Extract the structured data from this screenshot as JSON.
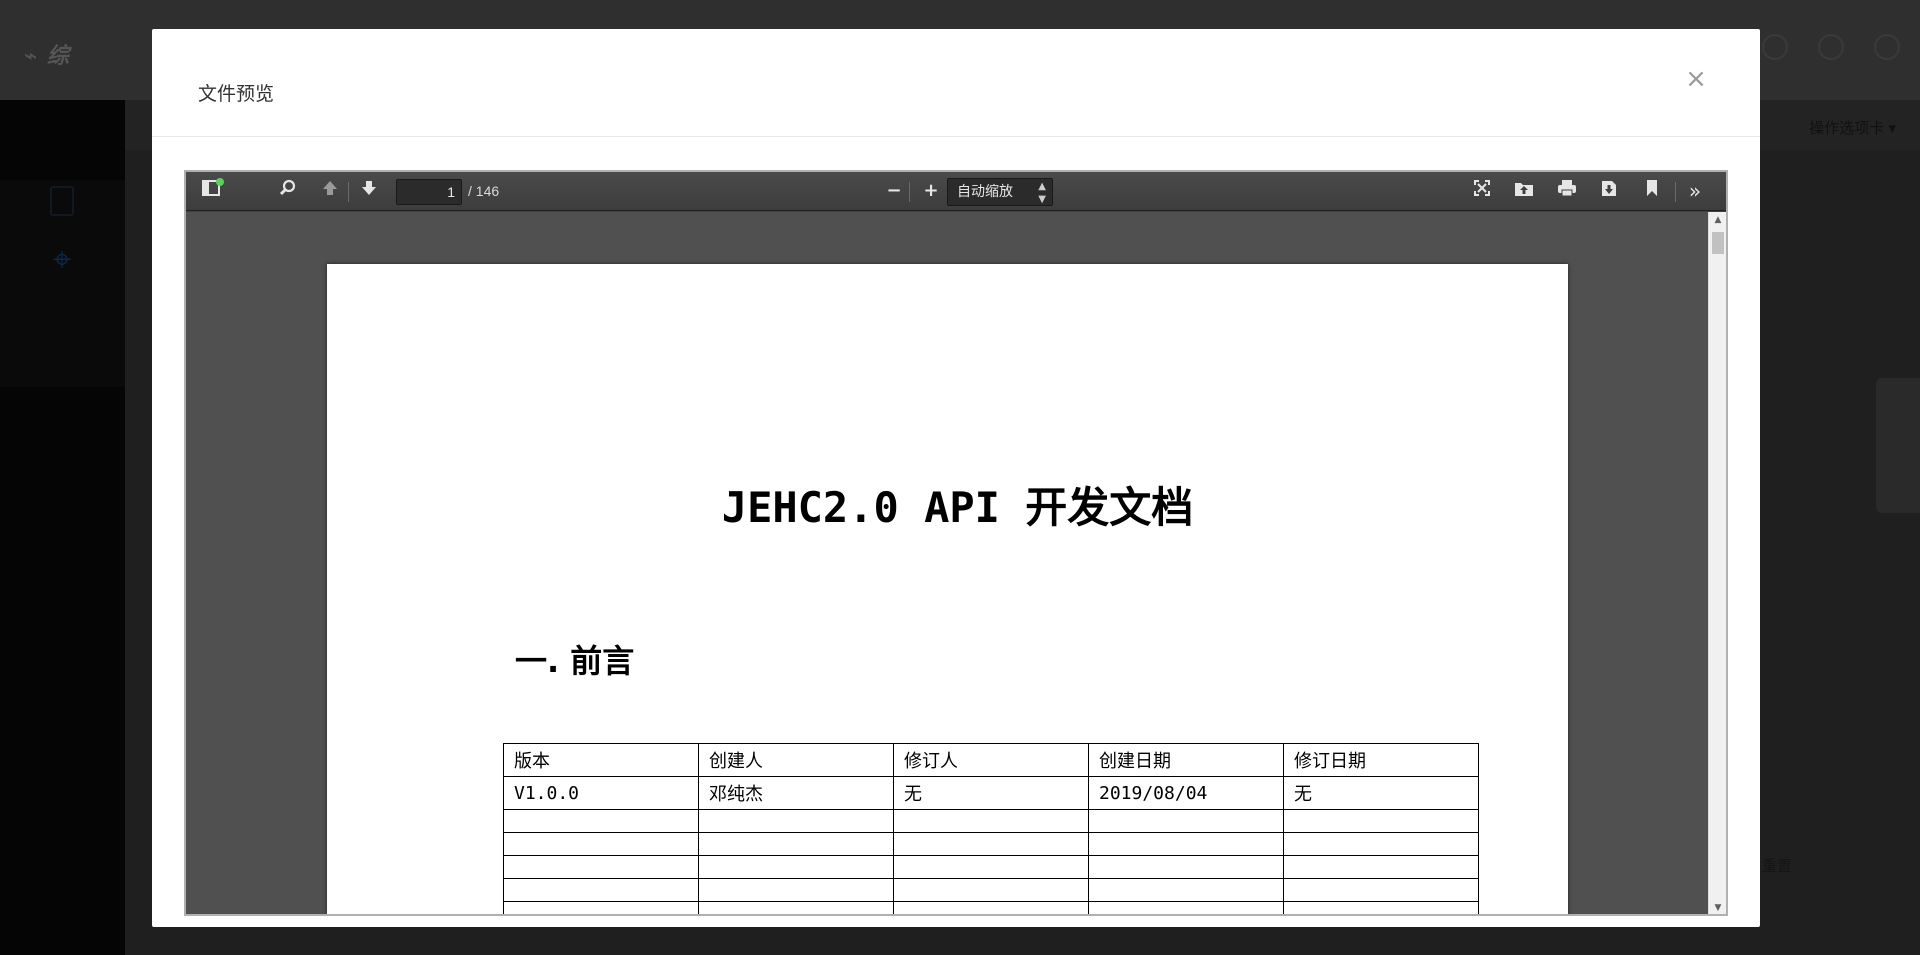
{
  "modal": {
    "title": "文件预览",
    "close_label": "×"
  },
  "background": {
    "tabs_menu": "操作选项卡 ▾",
    "reset_label": "重置"
  },
  "viewer": {
    "toolbar": {
      "current_page": "1",
      "page_total": "/ 146",
      "zoom_value": "自动缩放",
      "zoom_out": "−",
      "zoom_in": "+"
    }
  },
  "document": {
    "title": "JEHC2.0 API 开发文档",
    "section_heading": "一. 前言",
    "table": {
      "headers": [
        "版本",
        "创建人",
        "修订人",
        "创建日期",
        "修订日期"
      ],
      "rows": [
        [
          "V1.0.0",
          "邓纯杰",
          "无",
          "2019/08/04",
          "无"
        ],
        [
          "",
          "",
          "",
          "",
          ""
        ],
        [
          "",
          "",
          "",
          "",
          ""
        ],
        [
          "",
          "",
          "",
          "",
          ""
        ],
        [
          "",
          "",
          "",
          "",
          ""
        ],
        [
          "",
          "",
          "",
          "",
          ""
        ]
      ]
    }
  }
}
